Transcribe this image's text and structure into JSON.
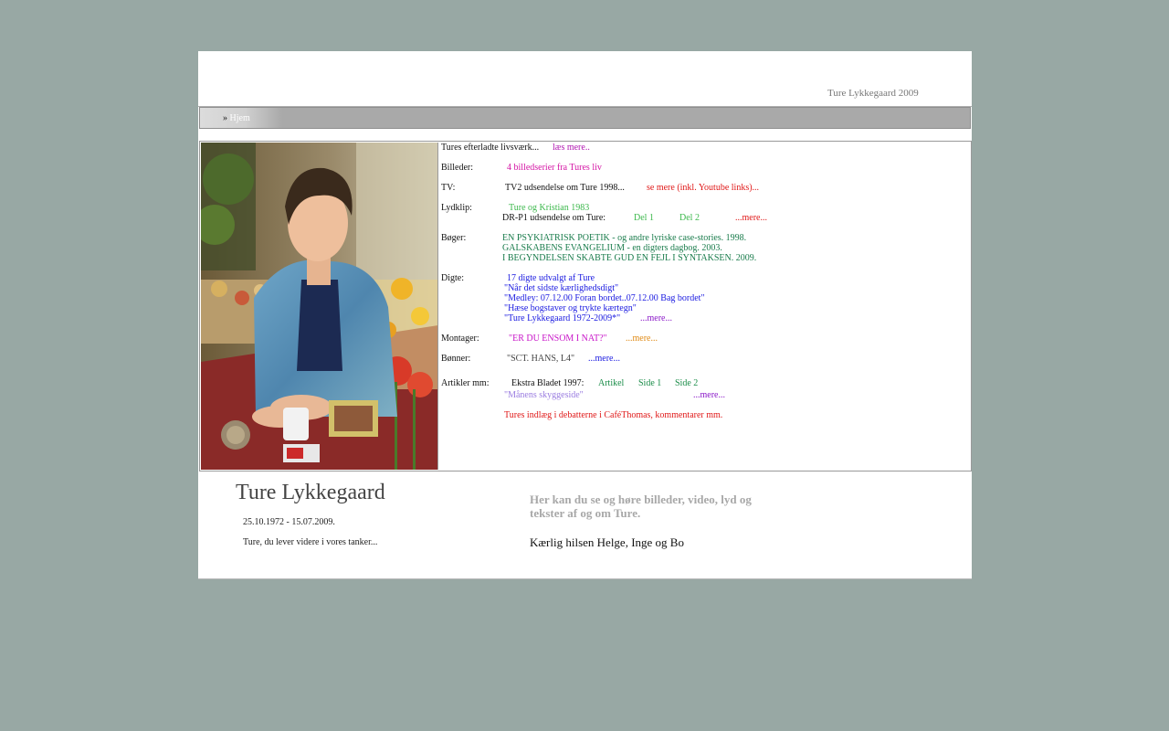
{
  "header": {
    "title": "Ture Lykkegaard 2009"
  },
  "nav": {
    "prefix": "»",
    "home_label": "Hjem"
  },
  "content": {
    "intro": {
      "text": "Tures efterladte livsværk...",
      "link": "læs mere..",
      "link_color": "#b015b0"
    },
    "billeder": {
      "label": "Billeder:",
      "link": "4 billedserier fra Tures liv",
      "link_color": "#d414a4"
    },
    "tv": {
      "label": "TV:",
      "text": "TV2 udsendelse om Ture 1998...",
      "link": "se mere (inkl. Youtube links)...",
      "link_color": "#e01818"
    },
    "lydklip": {
      "label": "Lydklip:",
      "link1": "Ture og Kristian 1983",
      "text": "DR-P1 udsendelse om Ture:",
      "del1": "Del 1",
      "del2": "Del 2",
      "more": "...mere...",
      "link_color": "#3cb84c",
      "more_color": "#e01818"
    },
    "boger": {
      "label": "Bøger:",
      "items": [
        "EN PSYKIATRISK POETIK - og andre lyriske case-stories. 1998.",
        "GALSKABENS EVANGELIUM - en digters dagbog. 2003.",
        "I BEGYNDELSEN SKABTE GUD EN FEJL I SYNTAKSEN. 2009."
      ],
      "color": "#1a7c4c"
    },
    "digte": {
      "label": "Digte:",
      "items": [
        "17 digte udvalgt af Ture",
        "\"Når det sidste kærlighedsdigt\"",
        "\"Medley: 07.12.00 Foran bordet..07.12.00 Bag bordet\"",
        "\"Hæse bogstaver og trykte kærtegn\"",
        "\"Ture Lykkegaard 1972-2009*\""
      ],
      "more": "...mere...",
      "color": "#1a1ae0",
      "more_color": "#8a18c8"
    },
    "montager": {
      "label": "Montager:",
      "link": "\"ER DU ENSOM I NAT?\"",
      "more": "...mere...",
      "link_color": "#c814c8",
      "more_color": "#e08a14"
    },
    "bonner": {
      "label": "Bønner:",
      "text": "\"SCT. HANS, L4\"",
      "more": "...mere...",
      "more_color": "#1a1ae0"
    },
    "artikler": {
      "label": "Artikler mm:",
      "text": "Ekstra Bladet 1997:",
      "artikel": "Artikel",
      "side1": "Side 1",
      "side2": "Side 2",
      "link_color": "#1a8c48",
      "manen": "\"Månens skyggeside\"",
      "manen_color": "#9a7ce0",
      "more": "...mere...",
      "more_color": "#8a18c8",
      "debate": "Tures indlæg i debatterne i CaféThomas, kommentarer mm.",
      "debate_color": "#e01818"
    }
  },
  "bottom": {
    "name": "Ture Lykkegaard",
    "dates": "25.10.1972 - 15.07.2009.",
    "tagline": "Ture, du lever videre i vores tanker...",
    "intro": "Her kan du se og høre billeder, video, lyd og tekster af og om Ture.",
    "greeting": "Kærlig hilsen Helge, Inge og Bo"
  }
}
